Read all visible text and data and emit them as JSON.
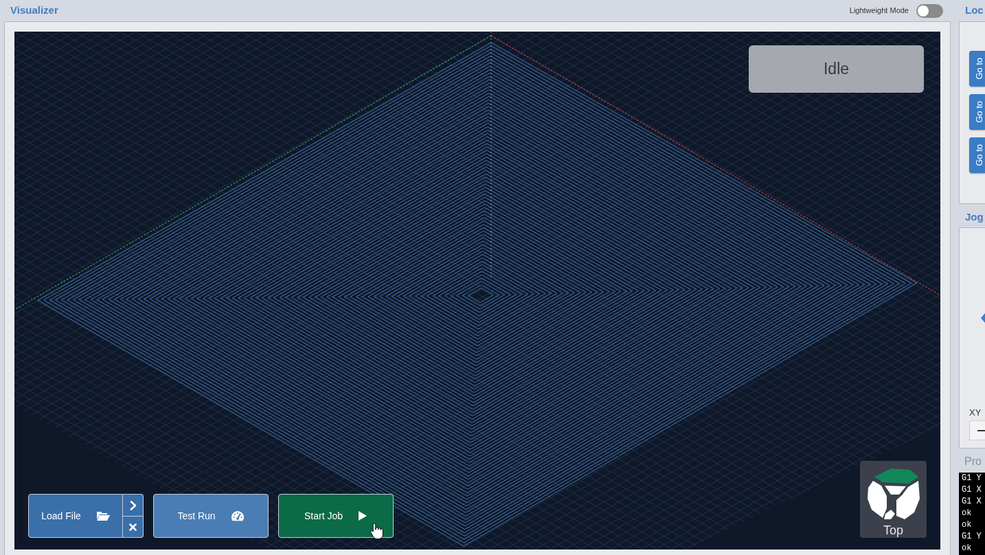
{
  "header": {
    "title": "Visualizer",
    "lightweight_mode": {
      "label": "Lightweight Mode",
      "on": false
    }
  },
  "visualizer": {
    "status": "Idle",
    "job_buttons": [
      {
        "kind": "load",
        "label": "Load File"
      },
      {
        "kind": "test",
        "label": "Test Run"
      },
      {
        "kind": "start",
        "label": "Start Job"
      }
    ],
    "view_cube": {
      "label": "Top"
    }
  },
  "side_panels": [
    {
      "kind": "location",
      "title": "Loc",
      "buttons": [
        "Go to",
        "Go to",
        "Go to"
      ]
    },
    {
      "kind": "jog",
      "title": "Jog",
      "label": "XY"
    },
    {
      "kind": "console",
      "title": "Pro",
      "lines": [
        "G1 Y",
        "G1 X",
        "G1 X",
        "ok",
        "ok",
        "G1 Y",
        "ok"
      ]
    }
  ]
}
